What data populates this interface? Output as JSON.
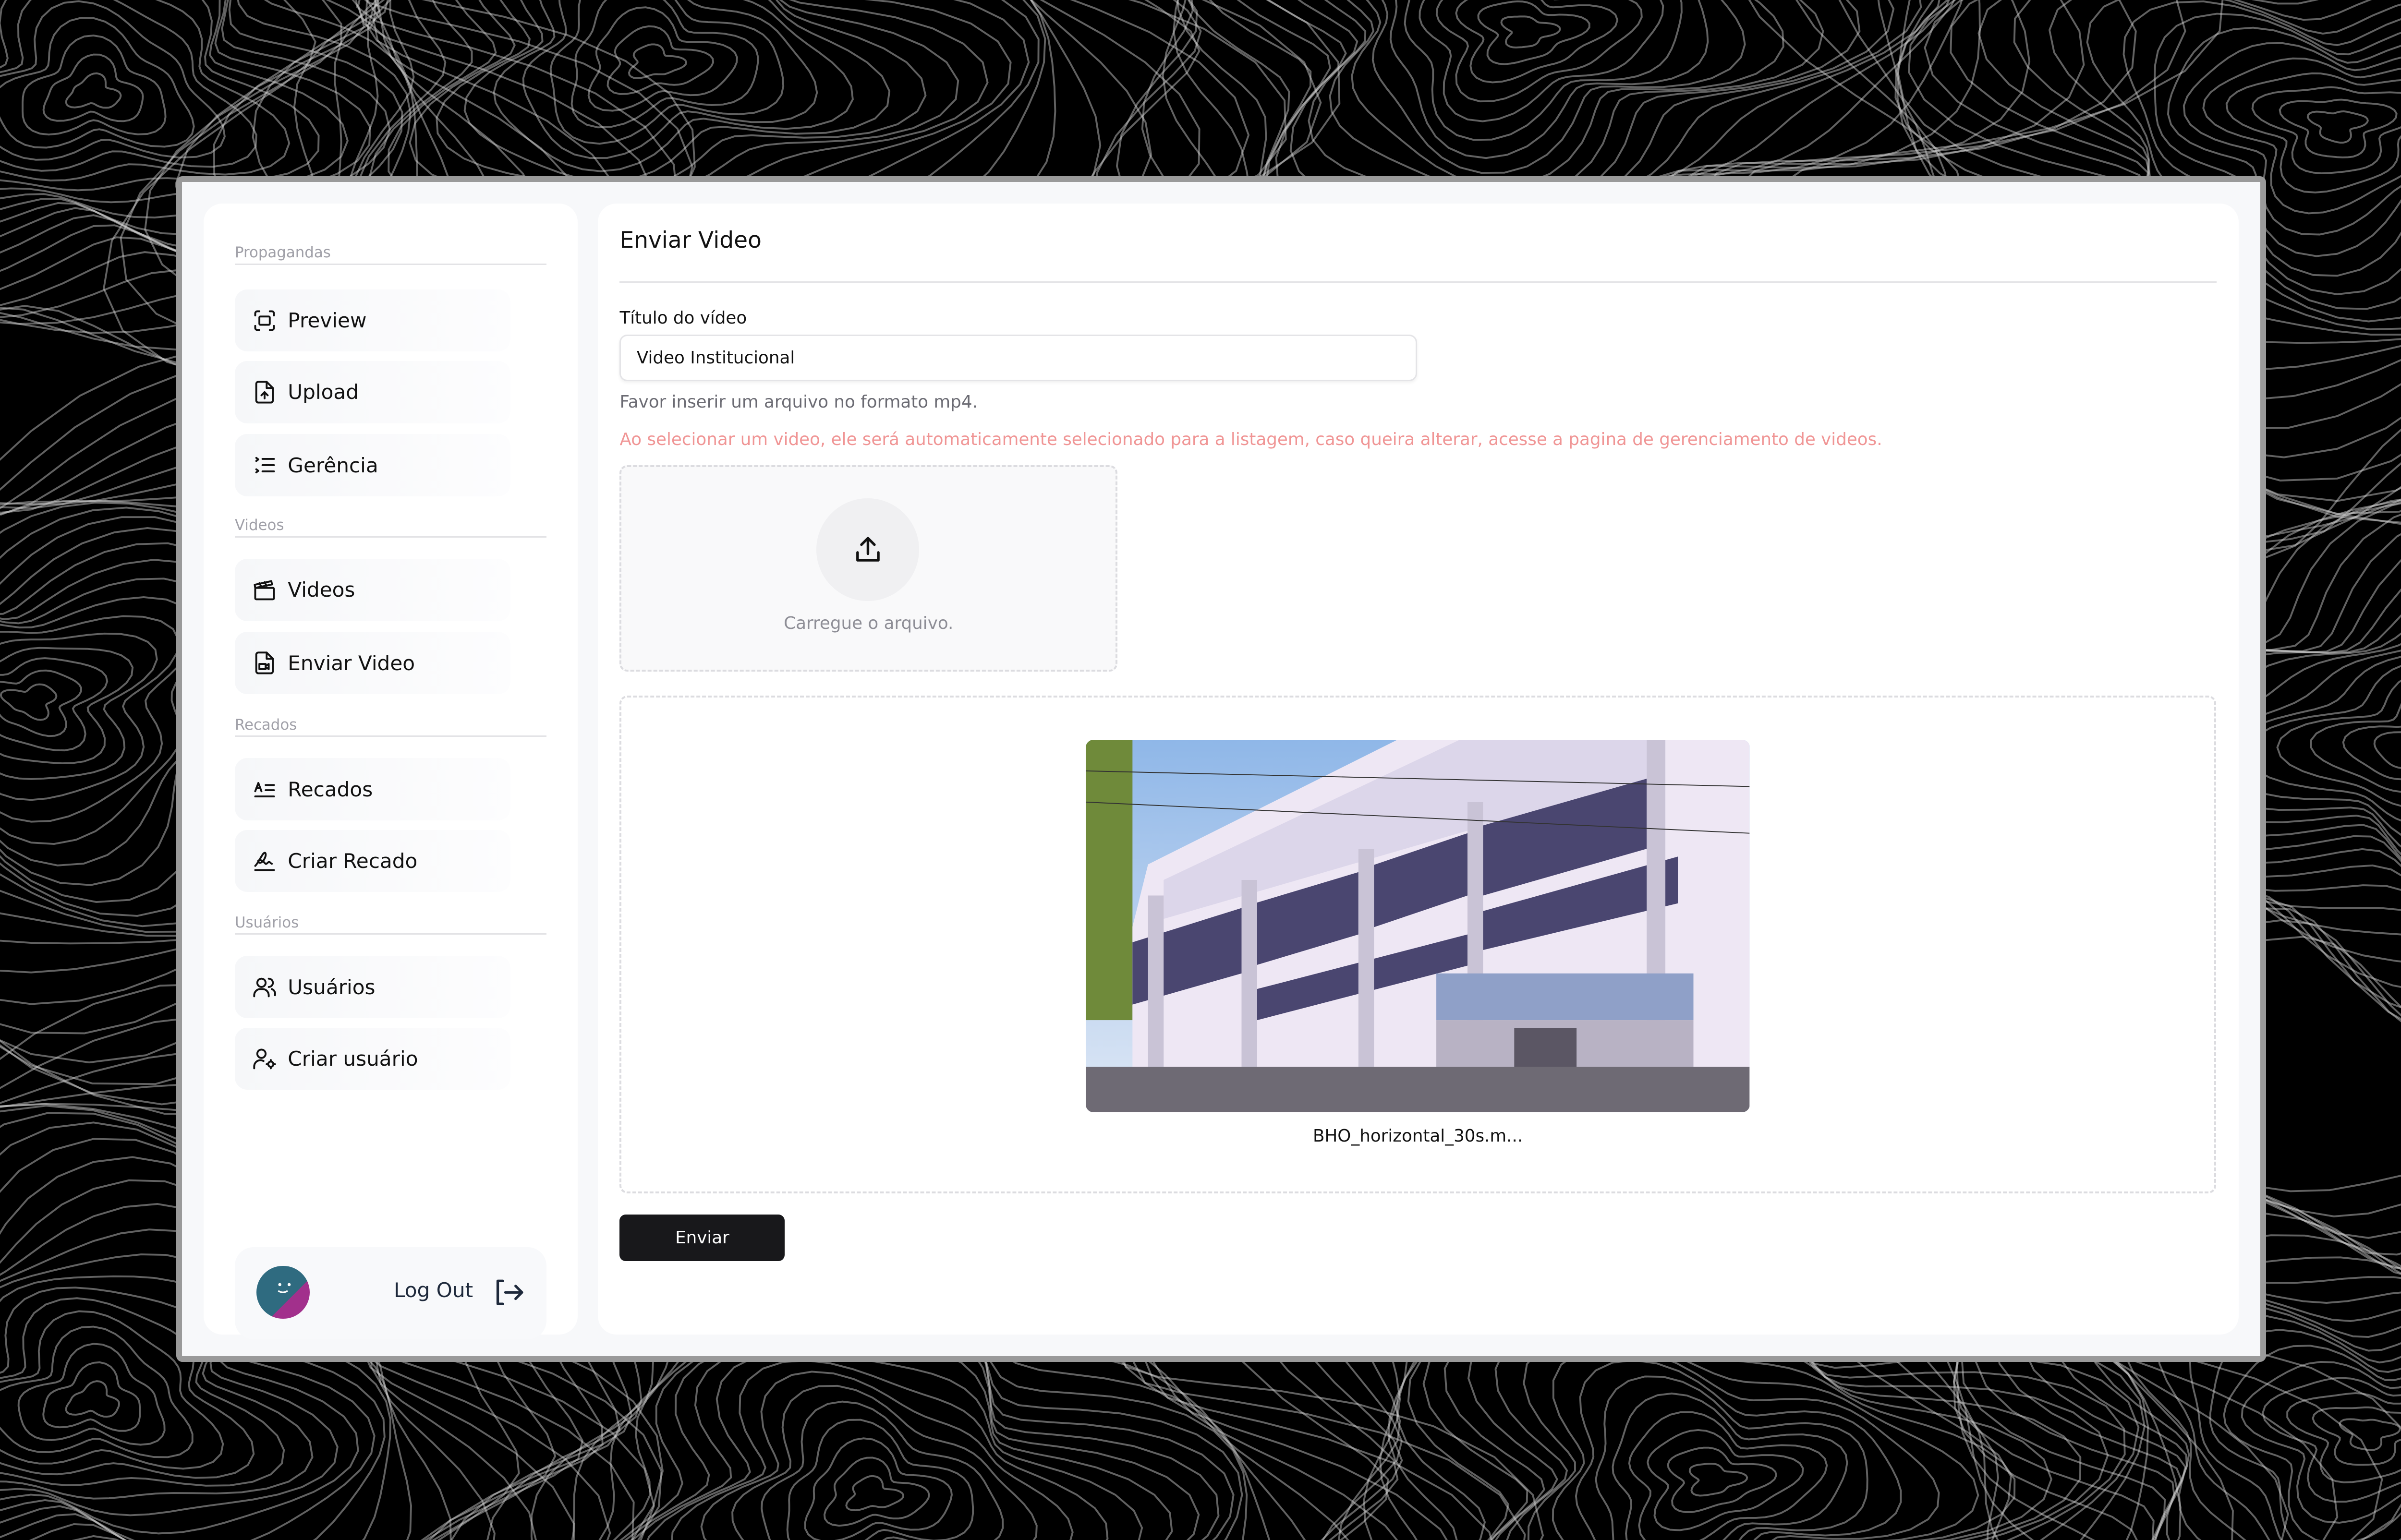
{
  "sidebar": {
    "sections": [
      {
        "label": "Propagandas",
        "items": [
          {
            "label": "Preview",
            "icon": "scan-icon"
          },
          {
            "label": "Upload",
            "icon": "file-upload-icon"
          },
          {
            "label": "Gerência",
            "icon": "list-ordered-icon"
          }
        ]
      },
      {
        "label": "Videos",
        "items": [
          {
            "label": "Videos",
            "icon": "clapperboard-icon"
          },
          {
            "label": "Enviar Video",
            "icon": "file-video-icon"
          }
        ]
      },
      {
        "label": "Recados",
        "items": [
          {
            "label": "Recados",
            "icon": "text-icon"
          },
          {
            "label": "Criar Recado",
            "icon": "signature-icon"
          }
        ]
      },
      {
        "label": "Usuários",
        "items": [
          {
            "label": "Usuários",
            "icon": "users-icon"
          },
          {
            "label": "Criar usuário",
            "icon": "user-cog-icon"
          }
        ]
      }
    ],
    "logout_label": "Log Out"
  },
  "main": {
    "title": "Enviar Video",
    "field_label": "Título do vídeo",
    "field_value": "Video Institucional",
    "hint": "Favor inserir um arquivo no formato mp4.",
    "warning": "Ao selecionar um video, ele será automaticamente selecionado para a listagem, caso queira alterar, acesse a pagina de gerenciamento de videos.",
    "dropzone_text": "Carregue o arquivo.",
    "file_name": "BHO_horizontal_30s.m...",
    "submit_label": "Enviar"
  },
  "colors": {
    "warning": "#f09595",
    "button": "#18181b",
    "background": "#000000"
  }
}
